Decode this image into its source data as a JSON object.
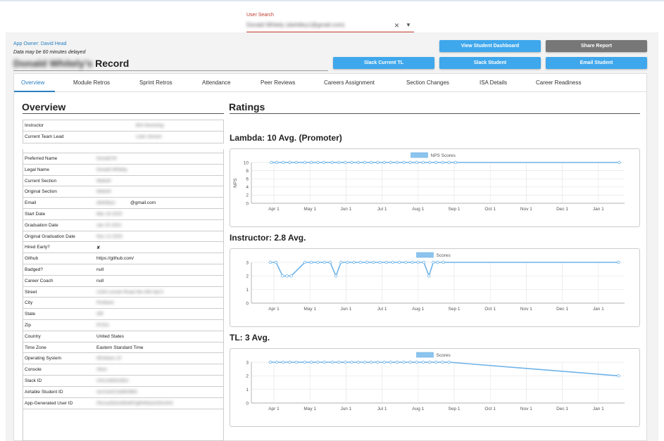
{
  "user_search": {
    "label": "User Search",
    "value": "Donald Whitely (dwhitley1@gmail.com)"
  },
  "app_owner": "App Owner: David Head",
  "delay_note": "Data may be 60 minutes delayed",
  "record": {
    "name": "Donald Whitely's",
    "suffix": "Record"
  },
  "buttons": {
    "view_dashboard": "View Student Dashboard",
    "share_report": "Share Report",
    "slack_tl": "Slack Current TL",
    "slack_student": "Slack Student",
    "email_student": "Email Student"
  },
  "tabs": [
    "Overview",
    "Module Retros",
    "Sprint Retros",
    "Attendance",
    "Peer Reviews",
    "Careers Assignment",
    "Section Changes",
    "ISA Details",
    "Career Readiness"
  ],
  "overview": {
    "title": "Overview",
    "team": [
      {
        "key": "Instructor",
        "value": "Brit Hemming"
      },
      {
        "key": "Current Team Lead",
        "value": "Luke Jensen"
      }
    ],
    "details": [
      {
        "key": "Preferred Name",
        "value": "Donald W"
      },
      {
        "key": "Legal Name",
        "value": "Donald Whitely"
      },
      {
        "key": "Current Section",
        "value": "Web34"
      },
      {
        "key": "Original Section",
        "value": "Web34"
      },
      {
        "key": "Email",
        "value": "dwhitley1",
        "suffix": "@gmail.com"
      },
      {
        "key": "Start Date",
        "value": "Mar 16 2020"
      },
      {
        "key": "Graduation Date",
        "value": "Jan 20 2021"
      },
      {
        "key": "Original Graduation Date",
        "value": "Nov 12 2020"
      },
      {
        "key": "Hired Early?",
        "value": "✘"
      },
      {
        "key": "Github",
        "value": "https://github.com/"
      },
      {
        "key": "Badged?",
        "value": "null"
      },
      {
        "key": "Career Coach",
        "value": "null"
      },
      {
        "key": "Street",
        "value": "1234 Lincoln Road Ste 300 Apt 5"
      },
      {
        "key": "City",
        "value": "Portland"
      },
      {
        "key": "State",
        "value": "OR"
      },
      {
        "key": "Zip",
        "value": "97201"
      },
      {
        "key": "Country",
        "value": "United States"
      },
      {
        "key": "Time Zone",
        "value": "Eastern Standard Time"
      },
      {
        "key": "Operating System",
        "value": "Windows 10"
      },
      {
        "key": "Console",
        "value": "Xbox"
      },
      {
        "key": "Slack ID",
        "value": "U012AB3CDE4"
      },
      {
        "key": "Airtable Student ID",
        "value": "recA1b2C3d4E5f6G"
      },
      {
        "key": "App-Generated User ID",
        "value": "00u1a2b3c4d5e6f7g8h9i0j1k2l3m4n5"
      }
    ]
  },
  "ratings": {
    "title": "Ratings",
    "charts": [
      {
        "title": "Lambda: 10 Avg. (Promoter)",
        "chart_data": {
          "type": "line",
          "legend": "NPS Scores",
          "ylabel": "NPS",
          "yticks": [
            0,
            2,
            4,
            6,
            8,
            10
          ],
          "ylim": [
            0,
            10
          ],
          "xticks": [
            "Apr 1",
            "May 1",
            "Jun 1",
            "Jul 1",
            "Aug 1",
            "Sep 1",
            "Oct 1",
            "Nov 1",
            "Dec 1",
            "Jan 1"
          ],
          "x": [
            0.0,
            0.04,
            0.11,
            0.15,
            0.22,
            0.26,
            0.33,
            0.37,
            0.44,
            0.51,
            0.55,
            0.62,
            0.66,
            0.73,
            0.77,
            0.84,
            0.88,
            1.01,
            1.08,
            1.12,
            1.19,
            1.23,
            1.3,
            1.34,
            1.41,
            1.45,
            1.52,
            1.56,
            1.63,
            1.67,
            1.74,
            1.78,
            1.85,
            1.88,
            1.92,
            1.99,
            2.03,
            2.1,
            2.17,
            2.21,
            2.28,
            2.32,
            2.35,
            2.4,
            2.44,
            2.48,
            2.55,
            2.59,
            2.66,
            2.7,
            2.77,
            2.81,
            2.88,
            2.92,
            3.0,
            3.05,
            3.09,
            3.16,
            3.2,
            3.27,
            3.31,
            3.38,
            3.42,
            3.49,
            3.53,
            3.6,
            3.64,
            3.71,
            3.75,
            3.82,
            3.86,
            3.93,
            3.97,
            4.04,
            4.08,
            4.15,
            4.19,
            4.26,
            4.3,
            4.37,
            4.41,
            4.48,
            4.52,
            4.59,
            4.63,
            4.7,
            4.74,
            4.81,
            4.85,
            4.92,
            4.96,
            5.03,
            5.07,
            5.14,
            5.18,
            5.25,
            5.29,
            5.36,
            5.4,
            5.47,
            5.51,
            5.58,
            5.62,
            5.69,
            5.73,
            5.8,
            5.84,
            5.91,
            5.95,
            6.02,
            6.06,
            6.13,
            6.17,
            6.24,
            6.28,
            6.35,
            6.39,
            6.46,
            6.5,
            6.57,
            6.61,
            6.68,
            6.72,
            6.79,
            6.83,
            6.9,
            6.94,
            7.01,
            7.05,
            7.12,
            7.16,
            7.23,
            7.27,
            7.34,
            7.38,
            7.45,
            7.49,
            7.56,
            7.6,
            7.67,
            7.71,
            7.78,
            7.82,
            7.89,
            7.93,
            8.0,
            8.04,
            8.11,
            8.15,
            8.22,
            8.26,
            8.33,
            8.37,
            8.44,
            8.48,
            8.55,
            8.59,
            8.66,
            8.7,
            8.77,
            8.81,
            8.88,
            8.92,
            8.99,
            9.03,
            9.1,
            9.14,
            9.21,
            9.25,
            9.32,
            9.36,
            9.43,
            9.47,
            9.54,
            9.58,
            9.65
          ],
          "points_x": [
            -0.07,
            0.08,
            0.26,
            0.44,
            0.62,
            0.86,
            1.04,
            1.22,
            1.38,
            1.62,
            1.8,
            1.98,
            2.16,
            2.34,
            2.52,
            2.7,
            2.88,
            3.06,
            3.24,
            3.42,
            3.6,
            3.78,
            3.96,
            4.14,
            4.32,
            4.5,
            4.68,
            4.86,
            5.04,
            9.58
          ],
          "values": [
            10,
            10,
            10,
            10,
            10,
            10,
            10,
            10,
            10,
            10,
            10,
            10,
            10,
            10,
            10,
            10,
            10,
            10,
            10,
            10,
            10,
            10,
            10,
            10,
            10,
            10,
            10,
            10,
            10,
            10
          ]
        }
      },
      {
        "title": "Instructor: 2.8 Avg.",
        "chart_data": {
          "type": "line",
          "legend": "Scores",
          "yticks": [
            0,
            1,
            2,
            3
          ],
          "ylim": [
            0,
            3
          ],
          "xticks": [
            "Apr 1",
            "May 1",
            "Jun 1",
            "Jul 1",
            "Aug 1",
            "Sep 1",
            "Oct 1",
            "Nov 1",
            "Dec 1",
            "Jan 1"
          ],
          "points_x": [
            -0.1,
            0.06,
            0.24,
            0.36,
            0.48,
            0.86,
            1.04,
            1.22,
            1.4,
            1.56,
            1.72,
            1.86,
            2.04,
            2.22,
            2.4,
            2.58,
            2.76,
            2.94,
            3.12,
            3.3,
            3.48,
            3.66,
            3.84,
            4.0,
            4.16,
            4.3,
            4.42,
            4.54,
            4.7,
            9.56
          ],
          "values": [
            3,
            3,
            2,
            2,
            2,
            3,
            3,
            3,
            3,
            3,
            2,
            3,
            3,
            3,
            3,
            3,
            3,
            3,
            3,
            3,
            3,
            3,
            3,
            3,
            3,
            2,
            3,
            3,
            3,
            3
          ]
        }
      },
      {
        "title": "TL: 3 Avg.",
        "chart_data": {
          "type": "line",
          "legend": "Scores",
          "yticks": [
            0,
            1,
            2,
            3
          ],
          "ylim": [
            0,
            3
          ],
          "xticks": [
            "Apr 1",
            "May 1",
            "Jun 1",
            "Jul 1",
            "Aug 1",
            "Sep 1",
            "Oct 1",
            "Nov 1",
            "Dec 1",
            "Jan 1"
          ],
          "points_x": [
            -0.1,
            0.08,
            0.26,
            0.44,
            0.62,
            0.86,
            1.04,
            1.22,
            1.4,
            1.62,
            1.8,
            1.98,
            2.16,
            2.34,
            2.52,
            2.7,
            2.88,
            3.06,
            3.24,
            3.42,
            3.6,
            3.78,
            3.96,
            4.14,
            4.32,
            4.5,
            4.68,
            4.86,
            9.56
          ],
          "values": [
            3,
            3,
            3,
            3,
            3,
            3,
            3,
            3,
            3,
            3,
            3,
            3,
            3,
            3,
            3,
            3,
            3,
            3,
            3,
            3,
            3,
            3,
            3,
            3,
            3,
            3,
            3,
            3,
            2
          ]
        }
      }
    ]
  },
  "colors": {
    "accent": "#2a7fc1",
    "button": "#3fa7ec",
    "line": "#6fb3e8",
    "search_underline": "#c0392b",
    "share": "#777777"
  }
}
